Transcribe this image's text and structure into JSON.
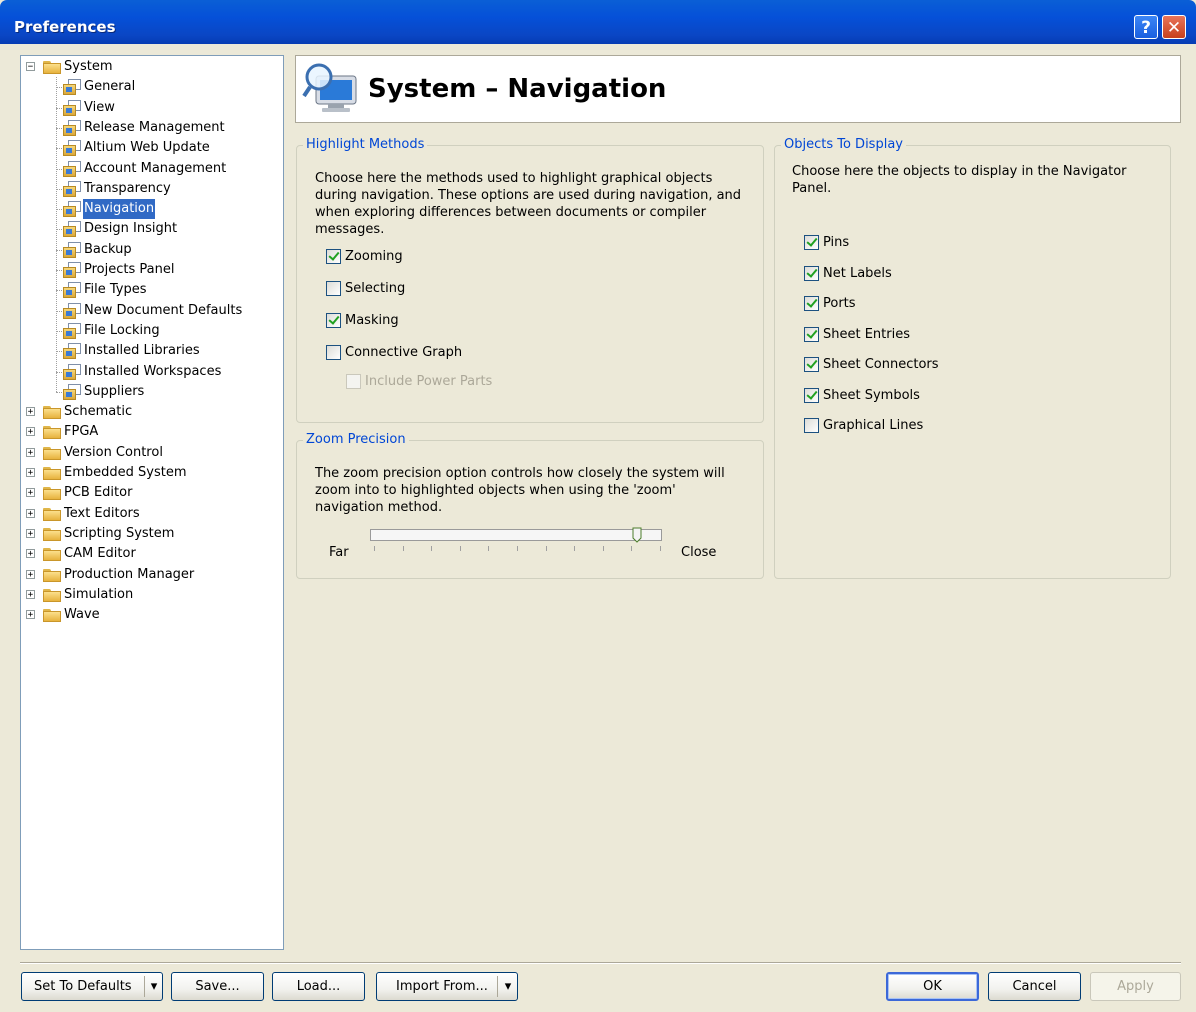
{
  "window": {
    "title": "Preferences",
    "help_icon": "help-icon",
    "close_icon": "close-icon"
  },
  "tree": {
    "system": {
      "label": "System",
      "expander": "−",
      "children": [
        {
          "label": "General"
        },
        {
          "label": "View"
        },
        {
          "label": "Release Management"
        },
        {
          "label": "Altium Web Update"
        },
        {
          "label": "Account Management"
        },
        {
          "label": "Transparency"
        },
        {
          "label": "Navigation",
          "selected": true
        },
        {
          "label": "Design Insight"
        },
        {
          "label": "Backup"
        },
        {
          "label": "Projects Panel"
        },
        {
          "label": "File Types"
        },
        {
          "label": "New Document Defaults"
        },
        {
          "label": "File Locking"
        },
        {
          "label": "Installed Libraries"
        },
        {
          "label": "Installed Workspaces"
        },
        {
          "label": "Suppliers"
        }
      ]
    },
    "roots": [
      {
        "label": "Schematic",
        "expander": "+"
      },
      {
        "label": "FPGA",
        "expander": "+"
      },
      {
        "label": "Version Control",
        "expander": "+"
      },
      {
        "label": "Embedded System",
        "expander": "+"
      },
      {
        "label": "PCB Editor",
        "expander": "+"
      },
      {
        "label": "Text Editors",
        "expander": "+"
      },
      {
        "label": "Scripting System",
        "expander": "+"
      },
      {
        "label": "CAM Editor",
        "expander": "+"
      },
      {
        "label": "Production Manager",
        "expander": "+"
      },
      {
        "label": "Simulation",
        "expander": "+"
      },
      {
        "label": "Wave",
        "expander": "+"
      }
    ]
  },
  "header": {
    "title": "System – Navigation"
  },
  "highlight_methods": {
    "title": "Highlight Methods",
    "description": "Choose here the methods used to highlight graphical objects during navigation. These options are used during navigation, and when exploring differences between documents or compiler messages.",
    "options": [
      {
        "label": "Zooming",
        "checked": true
      },
      {
        "label": "Selecting",
        "checked": false
      },
      {
        "label": "Masking",
        "checked": true
      },
      {
        "label": "Connective Graph",
        "checked": false
      }
    ],
    "include_power_parts": {
      "label": "Include Power Parts",
      "checked": false,
      "enabled": false
    }
  },
  "zoom_precision": {
    "title": "Zoom Precision",
    "description": "The zoom precision option controls how closely the system will zoom into to highlighted objects when using the 'zoom' navigation method.",
    "far_label": "Far",
    "close_label": "Close",
    "slider_level": 0.92,
    "ticks": 11
  },
  "objects_to_display": {
    "title": "Objects To Display",
    "description": "Choose here the objects to display in the Navigator Panel.",
    "options": [
      {
        "label": "Pins",
        "checked": true
      },
      {
        "label": "Net Labels",
        "checked": true
      },
      {
        "label": "Ports",
        "checked": true
      },
      {
        "label": "Sheet Entries",
        "checked": true
      },
      {
        "label": "Sheet Connectors",
        "checked": true
      },
      {
        "label": "Sheet Symbols",
        "checked": true
      },
      {
        "label": "Graphical Lines",
        "checked": false
      }
    ]
  },
  "footer": {
    "set_to_defaults": "Set To Defaults",
    "save": "Save...",
    "load": "Load...",
    "import_from": "Import From...",
    "ok": "OK",
    "cancel": "Cancel",
    "apply": "Apply",
    "dropdown_glyph": "▾"
  }
}
